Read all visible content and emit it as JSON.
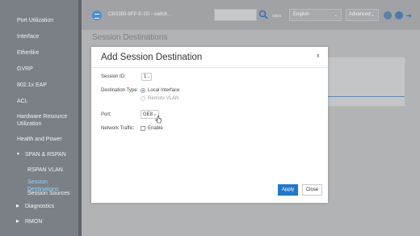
{
  "sidebar": {
    "items": [
      {
        "label": "Port Utilization"
      },
      {
        "label": "Interface"
      },
      {
        "label": "Etherlike"
      },
      {
        "label": "GVRP"
      },
      {
        "label": "802.1x EAP"
      },
      {
        "label": "ACL"
      },
      {
        "label": "Hardware Resource"
      },
      {
        "label": "Utilization"
      },
      {
        "label": "Health and Power"
      },
      {
        "label": "SPAN & RSPAN"
      },
      {
        "label": "RSPAN VLAN"
      },
      {
        "label": "Session Destinations"
      },
      {
        "label": "Session Sources"
      },
      {
        "label": "Diagnostics"
      },
      {
        "label": "RMON"
      }
    ]
  },
  "header": {
    "device_name": "CBS350-8FP-E-2G - switch...",
    "brand": "cisco",
    "language": "English",
    "mode": "Advanced"
  },
  "page": {
    "title": "Session Destinations"
  },
  "modal": {
    "title": "Add Session Destination",
    "close_label": "x",
    "session_id_label": "Session ID:",
    "session_id_value": "1",
    "destination_type_label": "Destination Type:",
    "destination_options": [
      "Local Interface",
      "Remote VLAN"
    ],
    "destination_selected": "Local Interface",
    "port_label": "Port:",
    "port_value": "GE8",
    "network_traffic_label": "Network Traffic:",
    "network_traffic_option": "Enable",
    "network_traffic_enabled": false,
    "apply_label": "Apply",
    "close_button_label": "Close"
  },
  "colors": {
    "sidebar_bg": "#7b8086",
    "active_item": "#8fd3ff",
    "primary_button": "#1f78c8"
  }
}
